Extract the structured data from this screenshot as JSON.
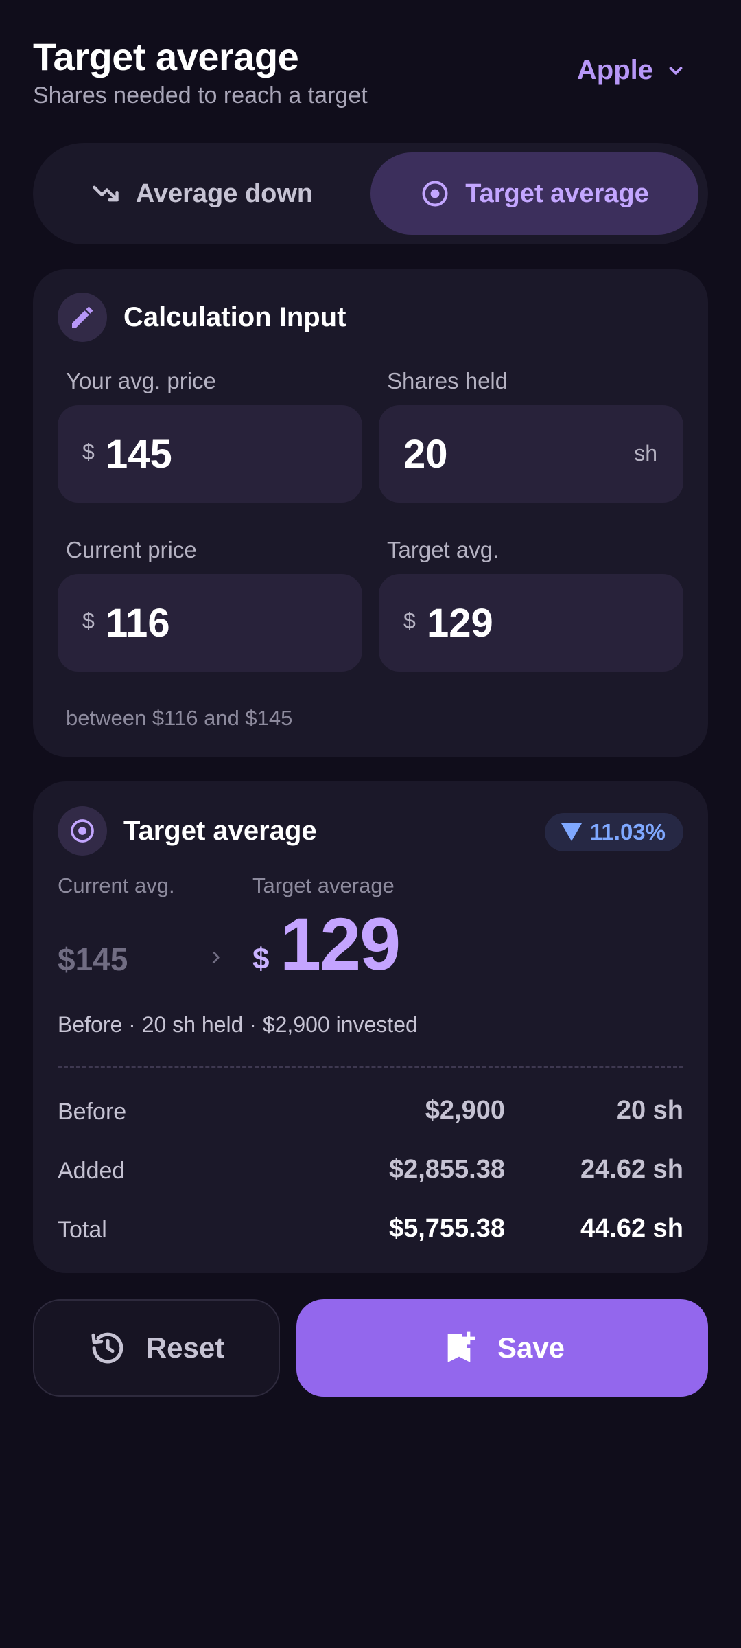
{
  "header": {
    "title": "Target average",
    "subtitle": "Shares needed to reach a target",
    "asset": "Apple"
  },
  "mode_tabs": [
    {
      "label": "Average down",
      "icon": "trending-down-icon",
      "selected": false
    },
    {
      "label": "Target average",
      "icon": "target-icon",
      "selected": true
    }
  ],
  "input_card": {
    "title": "Calculation Input",
    "icon": "pencil-icon",
    "fields": {
      "avg_price": {
        "label": "Your avg. price",
        "currency": "$",
        "value": "145"
      },
      "shares_held": {
        "label": "Shares held",
        "value": "20",
        "unit": "sh"
      },
      "current_price": {
        "label": "Current price",
        "currency": "$",
        "value": "116"
      },
      "target_avg": {
        "label": "Target avg.",
        "currency": "$",
        "value": "129"
      }
    },
    "hint": "between $116 and $145"
  },
  "result_card": {
    "title": "Target average",
    "icon": "target-icon",
    "badge": "11.03%",
    "current_avg_label": "Current avg.",
    "current_avg_value": "$145",
    "target_label": "Target average",
    "target_currency": "$",
    "target_value": "129",
    "summary": "Before · 20 sh held · $2,900 invested",
    "rows": [
      {
        "label": "Before",
        "amount": "$2,900",
        "shares": "20 sh"
      },
      {
        "label": "Added",
        "amount": "$2,855.38",
        "shares": "24.62 sh"
      },
      {
        "label": "Total",
        "amount": "$5,755.38",
        "shares": "44.62 sh"
      }
    ]
  },
  "actions": {
    "reset_label": "Reset",
    "save_label": "Save"
  },
  "colors": {
    "background": "#100d1b",
    "card": "#1b1829",
    "accent": "#9367ed",
    "accent_text": "#c4a4ff",
    "badge_text": "#7fa8ff"
  }
}
